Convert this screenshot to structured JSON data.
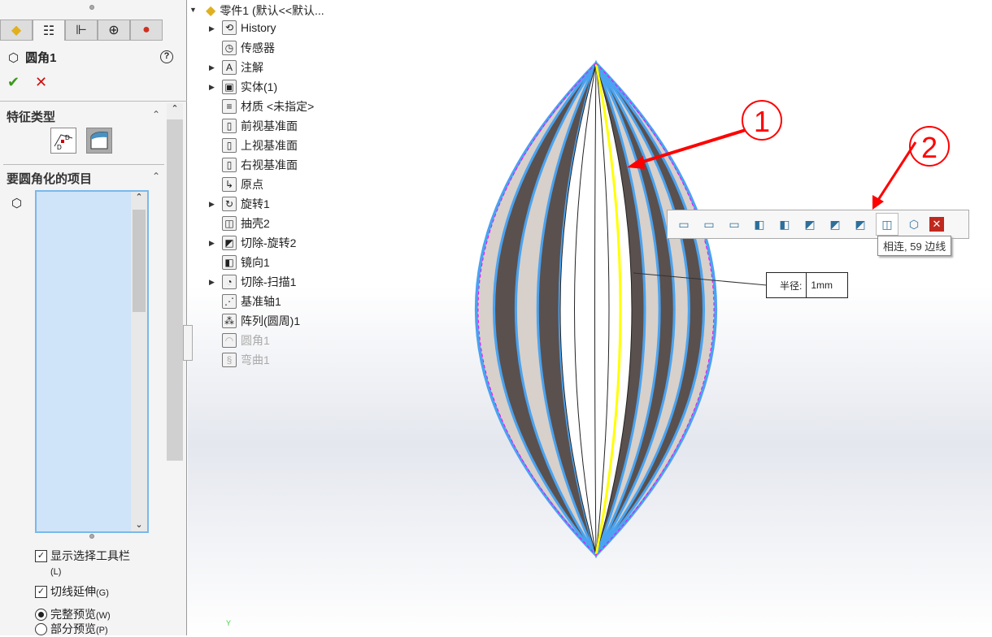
{
  "panel": {
    "tabs": [
      {
        "icon": "part-icon"
      },
      {
        "icon": "property-manager-icon"
      },
      {
        "icon": "configuration-manager-icon"
      },
      {
        "icon": "dimxpert-icon"
      },
      {
        "icon": "appearance-icon"
      }
    ],
    "title": "圆角1",
    "section1": "特征类型",
    "section2": "要圆角化的项目",
    "options": [
      {
        "label": "显示选择工具栏",
        "shortcut": "(L)",
        "type": "checkbox",
        "checked": true
      },
      {
        "label": "切线延伸",
        "shortcut": "(G)",
        "type": "checkbox",
        "checked": true
      },
      {
        "label": "完整预览",
        "shortcut": "(W)",
        "type": "radio",
        "checked": true
      },
      {
        "label": "部分预览",
        "shortcut": "(P)",
        "type": "radio",
        "checked": false
      }
    ]
  },
  "tree": {
    "root": "零件1  (默认<<默认...",
    "items": [
      {
        "label": "History",
        "expand": true,
        "icon": "history-folder-icon",
        "g": "⟲"
      },
      {
        "label": "传感器",
        "expand": false,
        "icon": "sensor-folder-icon",
        "g": "◷"
      },
      {
        "label": "注解",
        "expand": true,
        "icon": "annotation-folder-icon",
        "g": "A"
      },
      {
        "label": "实体(1)",
        "expand": true,
        "icon": "solid-bodies-folder-icon",
        "g": "▣"
      },
      {
        "label": "材质 <未指定>",
        "expand": false,
        "icon": "material-icon",
        "g": "≡"
      },
      {
        "label": "前视基准面",
        "expand": false,
        "icon": "plane-icon",
        "g": "▯"
      },
      {
        "label": "上视基准面",
        "expand": false,
        "icon": "plane-icon",
        "g": "▯"
      },
      {
        "label": "右视基准面",
        "expand": false,
        "icon": "plane-icon",
        "g": "▯"
      },
      {
        "label": "原点",
        "expand": false,
        "icon": "origin-icon",
        "g": "↳"
      },
      {
        "label": "旋转1",
        "expand": true,
        "icon": "revolve-icon",
        "g": "↻"
      },
      {
        "label": "抽壳2",
        "expand": false,
        "icon": "shell-icon",
        "g": "◫"
      },
      {
        "label": "切除-旋转2",
        "expand": true,
        "icon": "cut-revolve-icon",
        "g": "◩"
      },
      {
        "label": "镜向1",
        "expand": false,
        "icon": "mirror-icon",
        "g": "◧"
      },
      {
        "label": "切除-扫描1",
        "expand": true,
        "icon": "cut-sweep-icon",
        "g": "◔"
      },
      {
        "label": "基准轴1",
        "expand": false,
        "icon": "axis-icon",
        "g": "⋰"
      },
      {
        "label": "阵列(圆周)1",
        "expand": false,
        "icon": "circular-pattern-icon",
        "g": "⁂"
      },
      {
        "label": "圆角1",
        "expand": false,
        "icon": "fillet-icon",
        "g": "◠",
        "dim": true
      },
      {
        "label": "弯曲1",
        "expand": false,
        "icon": "flex-icon",
        "g": "§",
        "dim": true
      }
    ]
  },
  "selection_toolbar": {
    "tooltip": "相连, 59 边线"
  },
  "dimension": {
    "label": "半径:",
    "value": "1mm"
  },
  "annotations": [
    "1",
    "2"
  ],
  "triad": "Y",
  "colors": {
    "selected_edge": "#4aa3f0",
    "highlight": "#ffff00",
    "annotation": "#ff0000"
  }
}
